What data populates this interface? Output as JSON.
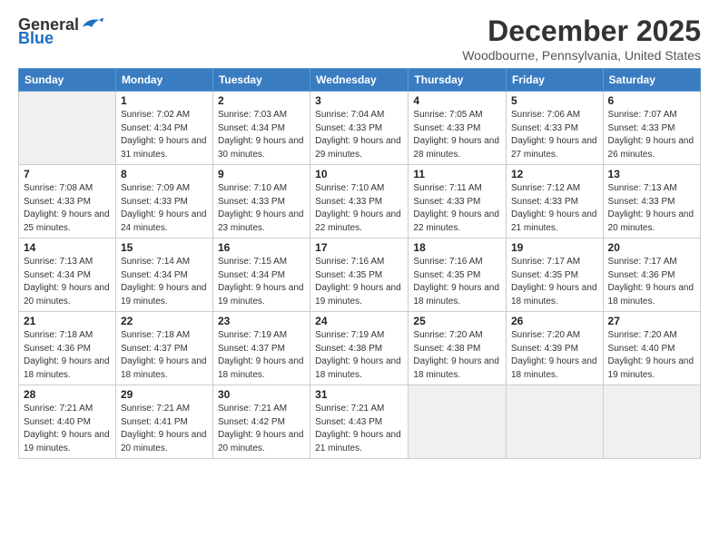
{
  "header": {
    "logo_general": "General",
    "logo_blue": "Blue",
    "month_title": "December 2025",
    "location": "Woodbourne, Pennsylvania, United States"
  },
  "columns": [
    "Sunday",
    "Monday",
    "Tuesday",
    "Wednesday",
    "Thursday",
    "Friday",
    "Saturday"
  ],
  "weeks": [
    [
      {
        "day": "",
        "empty": true
      },
      {
        "day": "1",
        "sunrise": "7:02 AM",
        "sunset": "4:34 PM",
        "daylight": "9 hours and 31 minutes."
      },
      {
        "day": "2",
        "sunrise": "7:03 AM",
        "sunset": "4:34 PM",
        "daylight": "9 hours and 30 minutes."
      },
      {
        "day": "3",
        "sunrise": "7:04 AM",
        "sunset": "4:33 PM",
        "daylight": "9 hours and 29 minutes."
      },
      {
        "day": "4",
        "sunrise": "7:05 AM",
        "sunset": "4:33 PM",
        "daylight": "9 hours and 28 minutes."
      },
      {
        "day": "5",
        "sunrise": "7:06 AM",
        "sunset": "4:33 PM",
        "daylight": "9 hours and 27 minutes."
      },
      {
        "day": "6",
        "sunrise": "7:07 AM",
        "sunset": "4:33 PM",
        "daylight": "9 hours and 26 minutes."
      }
    ],
    [
      {
        "day": "7",
        "sunrise": "7:08 AM",
        "sunset": "4:33 PM",
        "daylight": "9 hours and 25 minutes."
      },
      {
        "day": "8",
        "sunrise": "7:09 AM",
        "sunset": "4:33 PM",
        "daylight": "9 hours and 24 minutes."
      },
      {
        "day": "9",
        "sunrise": "7:10 AM",
        "sunset": "4:33 PM",
        "daylight": "9 hours and 23 minutes."
      },
      {
        "day": "10",
        "sunrise": "7:10 AM",
        "sunset": "4:33 PM",
        "daylight": "9 hours and 22 minutes."
      },
      {
        "day": "11",
        "sunrise": "7:11 AM",
        "sunset": "4:33 PM",
        "daylight": "9 hours and 22 minutes."
      },
      {
        "day": "12",
        "sunrise": "7:12 AM",
        "sunset": "4:33 PM",
        "daylight": "9 hours and 21 minutes."
      },
      {
        "day": "13",
        "sunrise": "7:13 AM",
        "sunset": "4:33 PM",
        "daylight": "9 hours and 20 minutes."
      }
    ],
    [
      {
        "day": "14",
        "sunrise": "7:13 AM",
        "sunset": "4:34 PM",
        "daylight": "9 hours and 20 minutes."
      },
      {
        "day": "15",
        "sunrise": "7:14 AM",
        "sunset": "4:34 PM",
        "daylight": "9 hours and 19 minutes."
      },
      {
        "day": "16",
        "sunrise": "7:15 AM",
        "sunset": "4:34 PM",
        "daylight": "9 hours and 19 minutes."
      },
      {
        "day": "17",
        "sunrise": "7:16 AM",
        "sunset": "4:35 PM",
        "daylight": "9 hours and 19 minutes."
      },
      {
        "day": "18",
        "sunrise": "7:16 AM",
        "sunset": "4:35 PM",
        "daylight": "9 hours and 18 minutes."
      },
      {
        "day": "19",
        "sunrise": "7:17 AM",
        "sunset": "4:35 PM",
        "daylight": "9 hours and 18 minutes."
      },
      {
        "day": "20",
        "sunrise": "7:17 AM",
        "sunset": "4:36 PM",
        "daylight": "9 hours and 18 minutes."
      }
    ],
    [
      {
        "day": "21",
        "sunrise": "7:18 AM",
        "sunset": "4:36 PM",
        "daylight": "9 hours and 18 minutes."
      },
      {
        "day": "22",
        "sunrise": "7:18 AM",
        "sunset": "4:37 PM",
        "daylight": "9 hours and 18 minutes."
      },
      {
        "day": "23",
        "sunrise": "7:19 AM",
        "sunset": "4:37 PM",
        "daylight": "9 hours and 18 minutes."
      },
      {
        "day": "24",
        "sunrise": "7:19 AM",
        "sunset": "4:38 PM",
        "daylight": "9 hours and 18 minutes."
      },
      {
        "day": "25",
        "sunrise": "7:20 AM",
        "sunset": "4:38 PM",
        "daylight": "9 hours and 18 minutes."
      },
      {
        "day": "26",
        "sunrise": "7:20 AM",
        "sunset": "4:39 PM",
        "daylight": "9 hours and 18 minutes."
      },
      {
        "day": "27",
        "sunrise": "7:20 AM",
        "sunset": "4:40 PM",
        "daylight": "9 hours and 19 minutes."
      }
    ],
    [
      {
        "day": "28",
        "sunrise": "7:21 AM",
        "sunset": "4:40 PM",
        "daylight": "9 hours and 19 minutes."
      },
      {
        "day": "29",
        "sunrise": "7:21 AM",
        "sunset": "4:41 PM",
        "daylight": "9 hours and 20 minutes."
      },
      {
        "day": "30",
        "sunrise": "7:21 AM",
        "sunset": "4:42 PM",
        "daylight": "9 hours and 20 minutes."
      },
      {
        "day": "31",
        "sunrise": "7:21 AM",
        "sunset": "4:43 PM",
        "daylight": "9 hours and 21 minutes."
      },
      {
        "day": "",
        "empty": true
      },
      {
        "day": "",
        "empty": true
      },
      {
        "day": "",
        "empty": true
      }
    ]
  ],
  "labels": {
    "sunrise": "Sunrise:",
    "sunset": "Sunset:",
    "daylight": "Daylight:"
  }
}
